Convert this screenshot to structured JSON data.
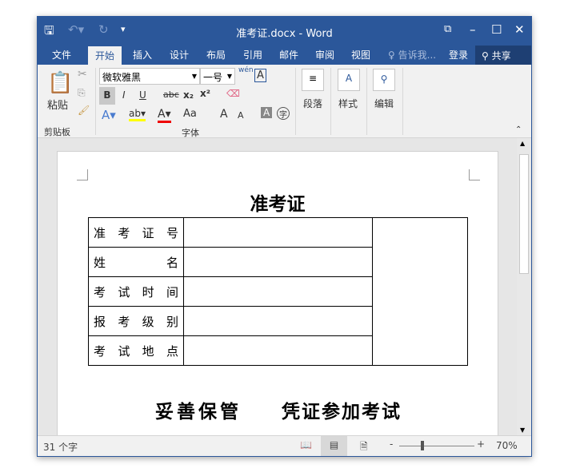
{
  "window": {
    "title": "准考证.docx - Word"
  },
  "tabs": [
    "文件",
    "开始",
    "插入",
    "设计",
    "布局",
    "引用",
    "邮件",
    "审阅",
    "视图"
  ],
  "tell_me": "告诉我...",
  "signin": "登录",
  "share": "共享",
  "ribbon": {
    "paste": "粘贴",
    "clipboard": "剪贴板",
    "font_name": "微软雅黑",
    "font_size": "一号",
    "font_group": "字体",
    "paragraph": "段落",
    "styles": "样式",
    "editing": "编辑",
    "bold": "B",
    "italic": "I",
    "underline": "U",
    "strike": "abc",
    "sub": "x₂",
    "sup": "x²",
    "grow": "A",
    "shrink": "A",
    "case": "Aa",
    "pinyin": "wén"
  },
  "document": {
    "title": "准考证",
    "rows": [
      "准考证号",
      "姓名",
      "考试时间",
      "报考级别",
      "考试地点"
    ],
    "footer_left": "妥善保管",
    "footer_right": "凭证参加考试"
  },
  "status": {
    "word_count": "31 个字",
    "zoom": "70%",
    "zoom_value": 70
  }
}
